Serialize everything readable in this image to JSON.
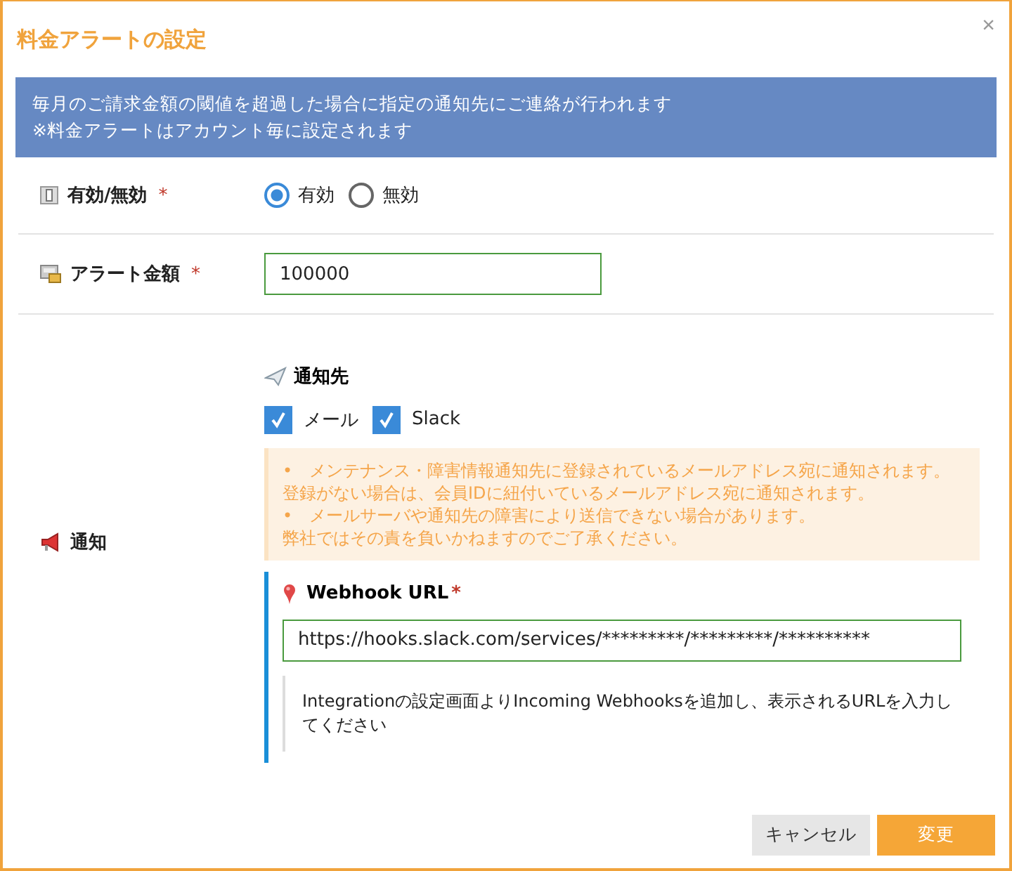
{
  "dialog": {
    "title": "料金アラートの設定",
    "close": "×"
  },
  "banner": {
    "lines": [
      "毎月のご請求金額の閾値を超過した場合に指定の通知先にご連絡が行われます",
      "※料金アラートはアカウント毎に設定されます"
    ]
  },
  "fields": [
    {
      "kind": "radio",
      "label": "有効/無効",
      "mark": "*",
      "options": [
        {
          "label": "有効",
          "selected": true
        },
        {
          "label": "無効",
          "selected": false
        }
      ]
    },
    {
      "kind": "text",
      "label": "アラート金額",
      "mark": "*",
      "value": "100000"
    },
    {
      "kind": "notify",
      "label": "通知",
      "destinations": {
        "heading": "通知先",
        "options": [
          {
            "label": "メール",
            "checked": true
          },
          {
            "label": "Slack",
            "checked": true
          }
        ]
      },
      "notes": [
        "•　メンテナンス・障害情報通知先に登録されているメールアドレス宛に通知されます。",
        "登録がない場合は、会員IDに紐付いているメールアドレス宛に通知されます。",
        "•　メールサーバや通知先の障害により送信できない場合があります。",
        "弊社ではその責を負いかねますのでご了承ください。"
      ],
      "webhook": {
        "label": "Webhook URL",
        "mark": "*",
        "value": "https://hooks.slack.com/services/*********/*********/**********",
        "help": "Integrationの設定画面よりIncoming Webhooksを追加し、表示されるURLを入力してください"
      }
    }
  ],
  "buttons": [
    {
      "label": "キャンセル",
      "kind": "secondary"
    },
    {
      "label": "変更",
      "kind": "primary"
    }
  ]
}
